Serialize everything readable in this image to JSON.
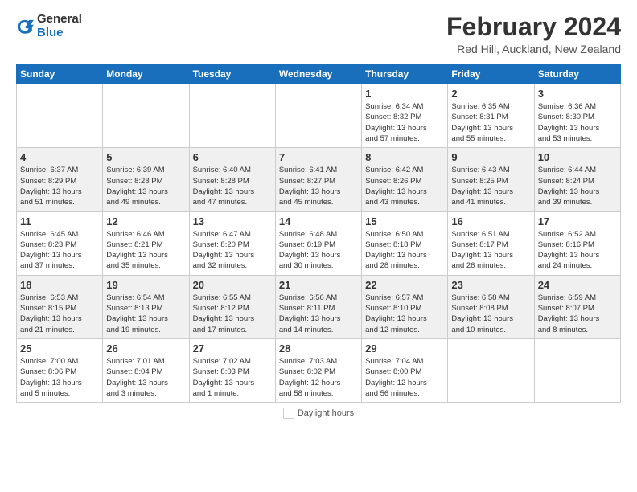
{
  "header": {
    "logo_line1": "General",
    "logo_line2": "Blue",
    "month_title": "February 2024",
    "location": "Red Hill, Auckland, New Zealand"
  },
  "days_of_week": [
    "Sunday",
    "Monday",
    "Tuesday",
    "Wednesday",
    "Thursday",
    "Friday",
    "Saturday"
  ],
  "footer": {
    "daylight_label": "Daylight hours"
  },
  "weeks": [
    [
      {
        "day": "",
        "info": ""
      },
      {
        "day": "",
        "info": ""
      },
      {
        "day": "",
        "info": ""
      },
      {
        "day": "",
        "info": ""
      },
      {
        "day": "1",
        "info": "Sunrise: 6:34 AM\nSunset: 8:32 PM\nDaylight: 13 hours\nand 57 minutes."
      },
      {
        "day": "2",
        "info": "Sunrise: 6:35 AM\nSunset: 8:31 PM\nDaylight: 13 hours\nand 55 minutes."
      },
      {
        "day": "3",
        "info": "Sunrise: 6:36 AM\nSunset: 8:30 PM\nDaylight: 13 hours\nand 53 minutes."
      }
    ],
    [
      {
        "day": "4",
        "info": "Sunrise: 6:37 AM\nSunset: 8:29 PM\nDaylight: 13 hours\nand 51 minutes."
      },
      {
        "day": "5",
        "info": "Sunrise: 6:39 AM\nSunset: 8:28 PM\nDaylight: 13 hours\nand 49 minutes."
      },
      {
        "day": "6",
        "info": "Sunrise: 6:40 AM\nSunset: 8:28 PM\nDaylight: 13 hours\nand 47 minutes."
      },
      {
        "day": "7",
        "info": "Sunrise: 6:41 AM\nSunset: 8:27 PM\nDaylight: 13 hours\nand 45 minutes."
      },
      {
        "day": "8",
        "info": "Sunrise: 6:42 AM\nSunset: 8:26 PM\nDaylight: 13 hours\nand 43 minutes."
      },
      {
        "day": "9",
        "info": "Sunrise: 6:43 AM\nSunset: 8:25 PM\nDaylight: 13 hours\nand 41 minutes."
      },
      {
        "day": "10",
        "info": "Sunrise: 6:44 AM\nSunset: 8:24 PM\nDaylight: 13 hours\nand 39 minutes."
      }
    ],
    [
      {
        "day": "11",
        "info": "Sunrise: 6:45 AM\nSunset: 8:23 PM\nDaylight: 13 hours\nand 37 minutes."
      },
      {
        "day": "12",
        "info": "Sunrise: 6:46 AM\nSunset: 8:21 PM\nDaylight: 13 hours\nand 35 minutes."
      },
      {
        "day": "13",
        "info": "Sunrise: 6:47 AM\nSunset: 8:20 PM\nDaylight: 13 hours\nand 32 minutes."
      },
      {
        "day": "14",
        "info": "Sunrise: 6:48 AM\nSunset: 8:19 PM\nDaylight: 13 hours\nand 30 minutes."
      },
      {
        "day": "15",
        "info": "Sunrise: 6:50 AM\nSunset: 8:18 PM\nDaylight: 13 hours\nand 28 minutes."
      },
      {
        "day": "16",
        "info": "Sunrise: 6:51 AM\nSunset: 8:17 PM\nDaylight: 13 hours\nand 26 minutes."
      },
      {
        "day": "17",
        "info": "Sunrise: 6:52 AM\nSunset: 8:16 PM\nDaylight: 13 hours\nand 24 minutes."
      }
    ],
    [
      {
        "day": "18",
        "info": "Sunrise: 6:53 AM\nSunset: 8:15 PM\nDaylight: 13 hours\nand 21 minutes."
      },
      {
        "day": "19",
        "info": "Sunrise: 6:54 AM\nSunset: 8:13 PM\nDaylight: 13 hours\nand 19 minutes."
      },
      {
        "day": "20",
        "info": "Sunrise: 6:55 AM\nSunset: 8:12 PM\nDaylight: 13 hours\nand 17 minutes."
      },
      {
        "day": "21",
        "info": "Sunrise: 6:56 AM\nSunset: 8:11 PM\nDaylight: 13 hours\nand 14 minutes."
      },
      {
        "day": "22",
        "info": "Sunrise: 6:57 AM\nSunset: 8:10 PM\nDaylight: 13 hours\nand 12 minutes."
      },
      {
        "day": "23",
        "info": "Sunrise: 6:58 AM\nSunset: 8:08 PM\nDaylight: 13 hours\nand 10 minutes."
      },
      {
        "day": "24",
        "info": "Sunrise: 6:59 AM\nSunset: 8:07 PM\nDaylight: 13 hours\nand 8 minutes."
      }
    ],
    [
      {
        "day": "25",
        "info": "Sunrise: 7:00 AM\nSunset: 8:06 PM\nDaylight: 13 hours\nand 5 minutes."
      },
      {
        "day": "26",
        "info": "Sunrise: 7:01 AM\nSunset: 8:04 PM\nDaylight: 13 hours\nand 3 minutes."
      },
      {
        "day": "27",
        "info": "Sunrise: 7:02 AM\nSunset: 8:03 PM\nDaylight: 13 hours\nand 1 minute."
      },
      {
        "day": "28",
        "info": "Sunrise: 7:03 AM\nSunset: 8:02 PM\nDaylight: 12 hours\nand 58 minutes."
      },
      {
        "day": "29",
        "info": "Sunrise: 7:04 AM\nSunset: 8:00 PM\nDaylight: 12 hours\nand 56 minutes."
      },
      {
        "day": "",
        "info": ""
      },
      {
        "day": "",
        "info": ""
      }
    ]
  ]
}
